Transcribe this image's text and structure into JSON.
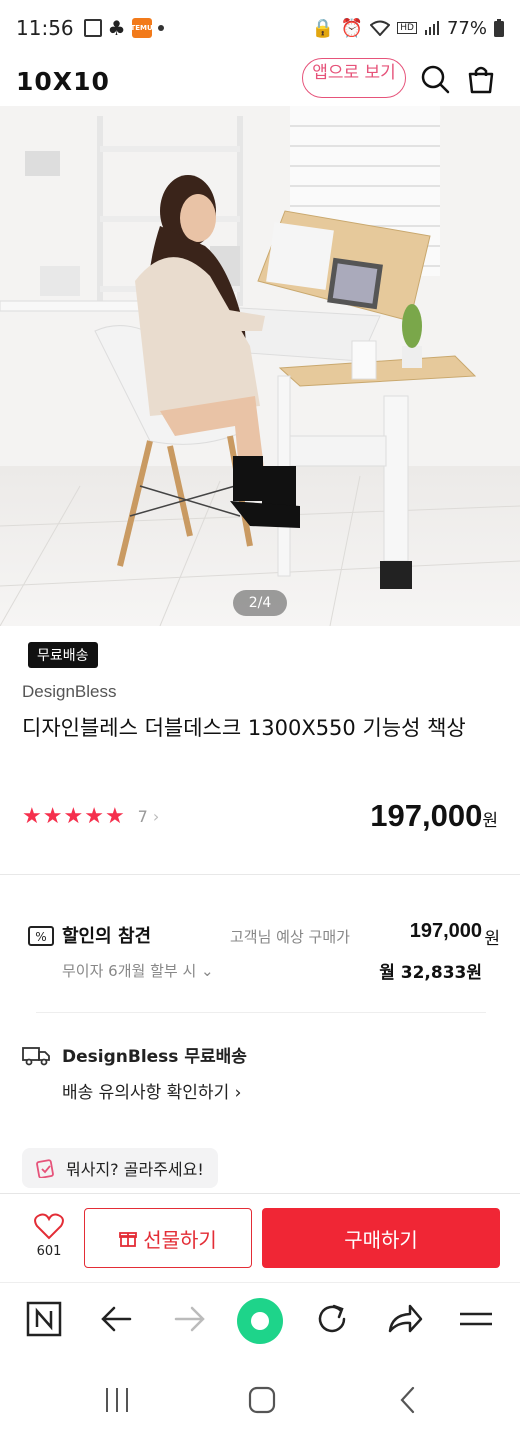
{
  "status_bar": {
    "time": "11:56",
    "battery": "77%",
    "temu_label": "TEMU"
  },
  "header": {
    "logo": "10X10",
    "app_view_label": "앱으로 보기"
  },
  "hero": {
    "pager": "2/4"
  },
  "product": {
    "badge": "무료배송",
    "brand": "DesignBless",
    "title": "디자인블레스 더블데스크 1300X550 기능성 책상",
    "rating_stars": 5,
    "review_count": "7",
    "price": "197,000",
    "price_unit": "원"
  },
  "discount": {
    "title": "할인의 참견",
    "expected_label": "고객님 예상 구매가",
    "expected_price": "197,000",
    "expected_unit": "원",
    "installment_label": "무이자 6개월 할부 시",
    "monthly_price": "월 32,833원"
  },
  "delivery": {
    "title": "DesignBless 무료배송",
    "notice_link": "배송 유의사항 확인하기"
  },
  "chip": {
    "label": "뭐사지? 골라주세요!"
  },
  "buy_bar": {
    "like_count": "601",
    "gift_label": "선물하기",
    "buy_label": "구매하기"
  },
  "colors": {
    "accent_red": "#f02635",
    "pink": "#e6537a",
    "star": "#f5304d"
  }
}
